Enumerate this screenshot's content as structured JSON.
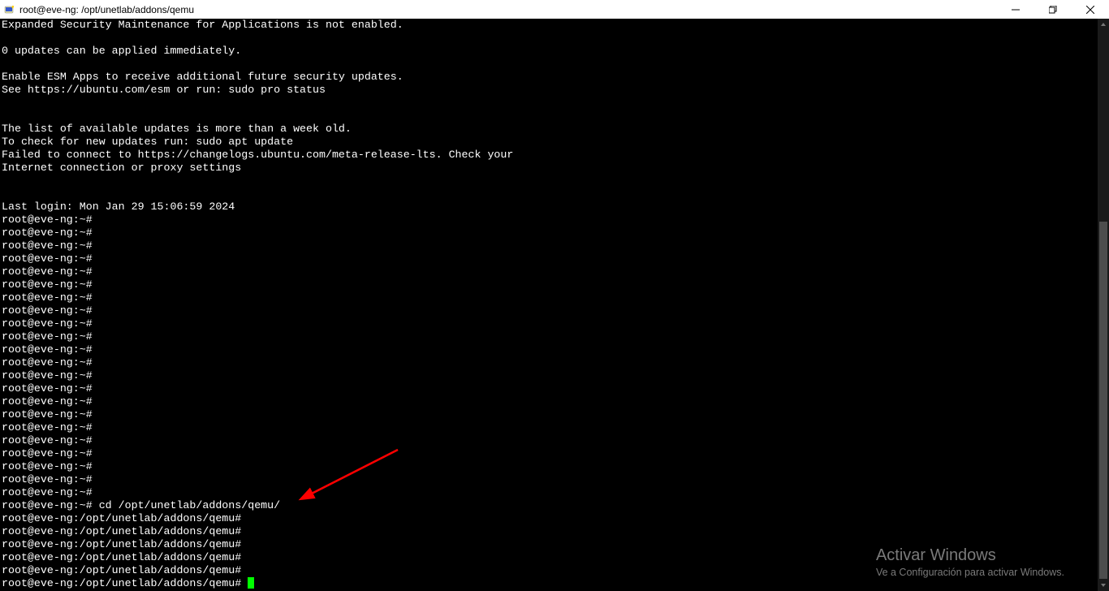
{
  "window": {
    "title": "root@eve-ng: /opt/unetlab/addons/qemu"
  },
  "terminal": {
    "lines": [
      "Expanded Security Maintenance for Applications is not enabled.",
      "",
      "0 updates can be applied immediately.",
      "",
      "Enable ESM Apps to receive additional future security updates.",
      "See https://ubuntu.com/esm or run: sudo pro status",
      "",
      "",
      "The list of available updates is more than a week old.",
      "To check for new updates run: sudo apt update",
      "Failed to connect to https://changelogs.ubuntu.com/meta-release-lts. Check your",
      "Internet connection or proxy settings",
      "",
      "",
      "Last login: Mon Jan 29 15:06:59 2024",
      "root@eve-ng:~#",
      "root@eve-ng:~#",
      "root@eve-ng:~#",
      "root@eve-ng:~#",
      "root@eve-ng:~#",
      "root@eve-ng:~#",
      "root@eve-ng:~#",
      "root@eve-ng:~#",
      "root@eve-ng:~#",
      "root@eve-ng:~#",
      "root@eve-ng:~#",
      "root@eve-ng:~#",
      "root@eve-ng:~#",
      "root@eve-ng:~#",
      "root@eve-ng:~#",
      "root@eve-ng:~#",
      "root@eve-ng:~#",
      "root@eve-ng:~#",
      "root@eve-ng:~#",
      "root@eve-ng:~#",
      "root@eve-ng:~#",
      "root@eve-ng:~#",
      "root@eve-ng:~# cd /opt/unetlab/addons/qemu/",
      "root@eve-ng:/opt/unetlab/addons/qemu#",
      "root@eve-ng:/opt/unetlab/addons/qemu#",
      "root@eve-ng:/opt/unetlab/addons/qemu#",
      "root@eve-ng:/opt/unetlab/addons/qemu#",
      "root@eve-ng:/opt/unetlab/addons/qemu#"
    ],
    "current_prompt": "root@eve-ng:/opt/unetlab/addons/qemu# "
  },
  "watermark": {
    "line1": "Activar Windows",
    "line2": "Ve a Configuración para activar Windows."
  },
  "annotation": {
    "arrow": "red-arrow"
  }
}
